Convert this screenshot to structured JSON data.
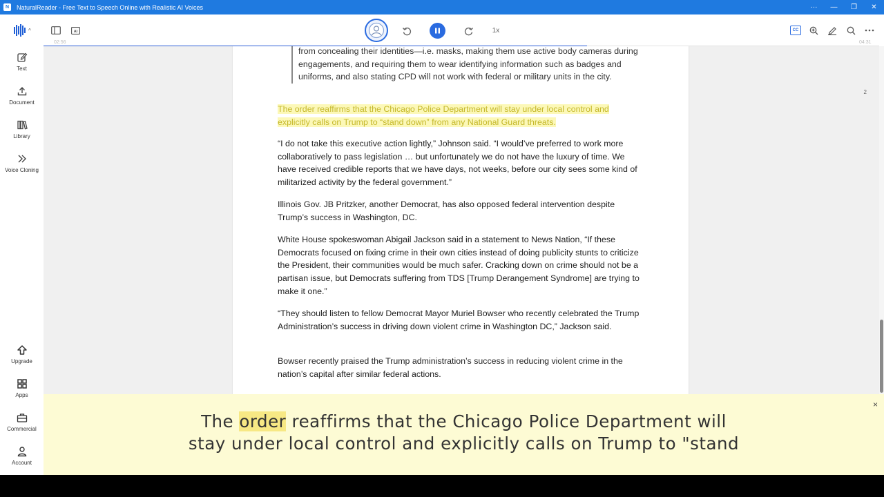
{
  "window": {
    "title": "NaturalReader - Free Text to Speech Online with Realistic AI Voices",
    "icon_label": "N",
    "buttons": [
      "···",
      "—",
      "❐",
      "✕"
    ]
  },
  "sidebar": {
    "logo_caret": "^",
    "items": [
      {
        "label": "Text",
        "icon": "pencil-square-icon"
      },
      {
        "label": "Document",
        "icon": "upload-icon"
      },
      {
        "label": "Library",
        "icon": "books-icon"
      },
      {
        "label": "Voice Cloning",
        "icon": "double-chevron-icon"
      }
    ],
    "bottom_items": [
      {
        "label": "Upgrade",
        "icon": "upgrade-arrow-icon"
      },
      {
        "label": "Apps",
        "icon": "grid-icon"
      },
      {
        "label": "Commercial",
        "icon": "briefcase-icon"
      },
      {
        "label": "Account",
        "icon": "person-icon"
      }
    ]
  },
  "toolbar": {
    "speed": "1x",
    "time_elapsed": "02:56",
    "time_total": "04:31",
    "progress": 0.65,
    "cc_label": "CC",
    "ai_label": "AI"
  },
  "document": {
    "page_number": "2",
    "blockquote": "from concealing their identities—i.e. masks, making them use active body cameras during engagements, and requiring them to wear identifying information such as badges and uniforms, and also stating CPD will not work with federal or military units in the city.",
    "highlighted": "The order reaffirms that the Chicago Police Department will stay under local control and explicitly calls on Trump to “stand down” from any National Guard threats.",
    "paragraphs": [
      "“I do not take this executive action lightly,” Johnson said. “I would’ve preferred to work more collaboratively to pass legislation … but unfortunately we do not have the luxury of time. We have received credible reports that we have days, not weeks, before our city sees some kind of militarized activity by the federal government.”",
      "Illinois Gov. JB Pritzker, another Democrat, has also opposed federal intervention despite Trump’s success in Washington, DC.",
      "White House spokeswoman Abigail Jackson said in a statement to News Nation, “If these Democrats focused on fixing crime in their own cities instead of doing publicity stunts to criticize the President, their communities would be much safer. Cracking down on crime should not be a partisan issue, but Democrats suffering from TDS [Trump Derangement Syndrome] are trying to make it one.”",
      "“They should listen to fellow Democrat Mayor Muriel Bowser who recently celebrated the Trump Administration’s success in driving down violent crime in Washington DC,” Jackson said.",
      "Bowser recently praised the Trump administration’s success in reducing violent crime in the nation’s capital after similar federal actions."
    ]
  },
  "caption": {
    "before": "The ",
    "current_word": "order",
    "after_line1": " reaffirms that the Chicago Police Department will",
    "line2": "stay under local control and explicitly calls on Trump to \"stand",
    "close": "×"
  }
}
